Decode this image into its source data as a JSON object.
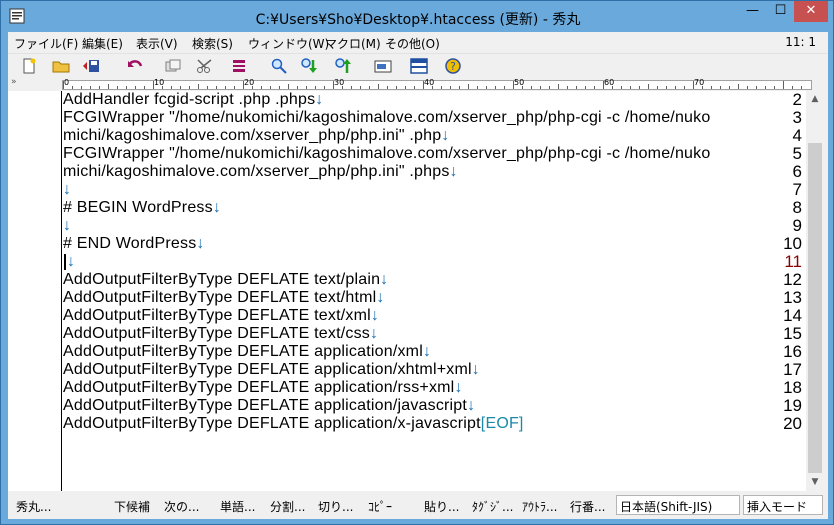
{
  "window": {
    "title": "C:¥Users¥Sho¥Desktop¥.htaccess (更新) - 秀丸",
    "minimize_glyph": "—",
    "maximize_glyph": "☐",
    "close_glyph": "✕"
  },
  "menu": {
    "items": [
      "ファイル(F)",
      "編集(E)",
      "表示(V)",
      "検索(S)",
      "ウィンドウ(W)",
      "マクロ(M)",
      "その他(O)"
    ],
    "position": "11: 1"
  },
  "toolbar": {
    "icons": [
      "new-file-icon",
      "open-folder-icon",
      "save-icon",
      "undo-icon",
      "copy-icon",
      "cut-icon",
      "paste-icon",
      "find-icon",
      "find-next-icon",
      "find-prev-icon",
      "window-icon",
      "split-icon",
      "help-icon"
    ]
  },
  "ruler": {
    "double_arrow": "»",
    "numbers": [
      "0",
      "10",
      "20",
      "30",
      "40",
      "50",
      "60",
      "70"
    ]
  },
  "editor": {
    "lines": [
      {
        "no": "2",
        "text": "AddHandler fcgid-script .php .phps",
        "nl": "↓"
      },
      {
        "no": "3",
        "text": "FCGIWrapper \"/home/nukomichi/kagoshimalove.com/xserver_php/php-cgi -c /home/nuko",
        "nl": ""
      },
      {
        "no": "4",
        "text": "michi/kagoshimalove.com/xserver_php/php.ini\" .php",
        "nl": "↓"
      },
      {
        "no": "5",
        "text": "FCGIWrapper \"/home/nukomichi/kagoshimalove.com/xserver_php/php-cgi -c /home/nuko",
        "nl": ""
      },
      {
        "no": "6",
        "text": "michi/kagoshimalove.com/xserver_php/php.ini\" .phps",
        "nl": "↓"
      },
      {
        "no": "7",
        "text": "",
        "nl": "↓"
      },
      {
        "no": "8",
        "text": "# BEGIN WordPress",
        "nl": "↓"
      },
      {
        "no": "9",
        "text": "",
        "nl": "↓"
      },
      {
        "no": "10",
        "text": "# END WordPress",
        "nl": "↓"
      },
      {
        "no": "11",
        "text": "",
        "nl": "↓"
      },
      {
        "no": "12",
        "text": "AddOutputFilterByType DEFLATE text/plain",
        "nl": "↓"
      },
      {
        "no": "13",
        "text": "AddOutputFilterByType DEFLATE text/html",
        "nl": "↓"
      },
      {
        "no": "14",
        "text": "AddOutputFilterByType DEFLATE text/xml",
        "nl": "↓"
      },
      {
        "no": "15",
        "text": "AddOutputFilterByType DEFLATE text/css",
        "nl": "↓"
      },
      {
        "no": "16",
        "text": "AddOutputFilterByType DEFLATE application/xml",
        "nl": "↓"
      },
      {
        "no": "17",
        "text": "AddOutputFilterByType DEFLATE application/xhtml+xml",
        "nl": "↓"
      },
      {
        "no": "18",
        "text": "AddOutputFilterByType DEFLATE application/rss+xml",
        "nl": "↓"
      },
      {
        "no": "19",
        "text": "AddOutputFilterByType DEFLATE application/javascript",
        "nl": "↓"
      },
      {
        "no": "20",
        "text": "AddOutputFilterByType DEFLATE application/x-javascript",
        "nl": "[EOF]"
      }
    ],
    "current_line": "11"
  },
  "scrollbar": {
    "up": "▲",
    "down": "▼"
  },
  "status": {
    "app": "秀丸...",
    "items": [
      "下候補",
      "次の...",
      "単語...",
      "分割...",
      "切り...",
      "ｺﾋﾟｰ",
      "貼り...",
      "ﾀｸﾞｼﾞ...",
      "ｱｳﾄﾗ...",
      "行番..."
    ],
    "encoding": "日本語(Shift-JIS)",
    "mode": "挿入モード"
  },
  "colors": {
    "titlebar": "#6aa9dc",
    "close_button": "#c75050",
    "newline_mark": "#1a6fb0",
    "eof_mark": "#1a8aa8",
    "current_line_no": "#8b0000"
  }
}
